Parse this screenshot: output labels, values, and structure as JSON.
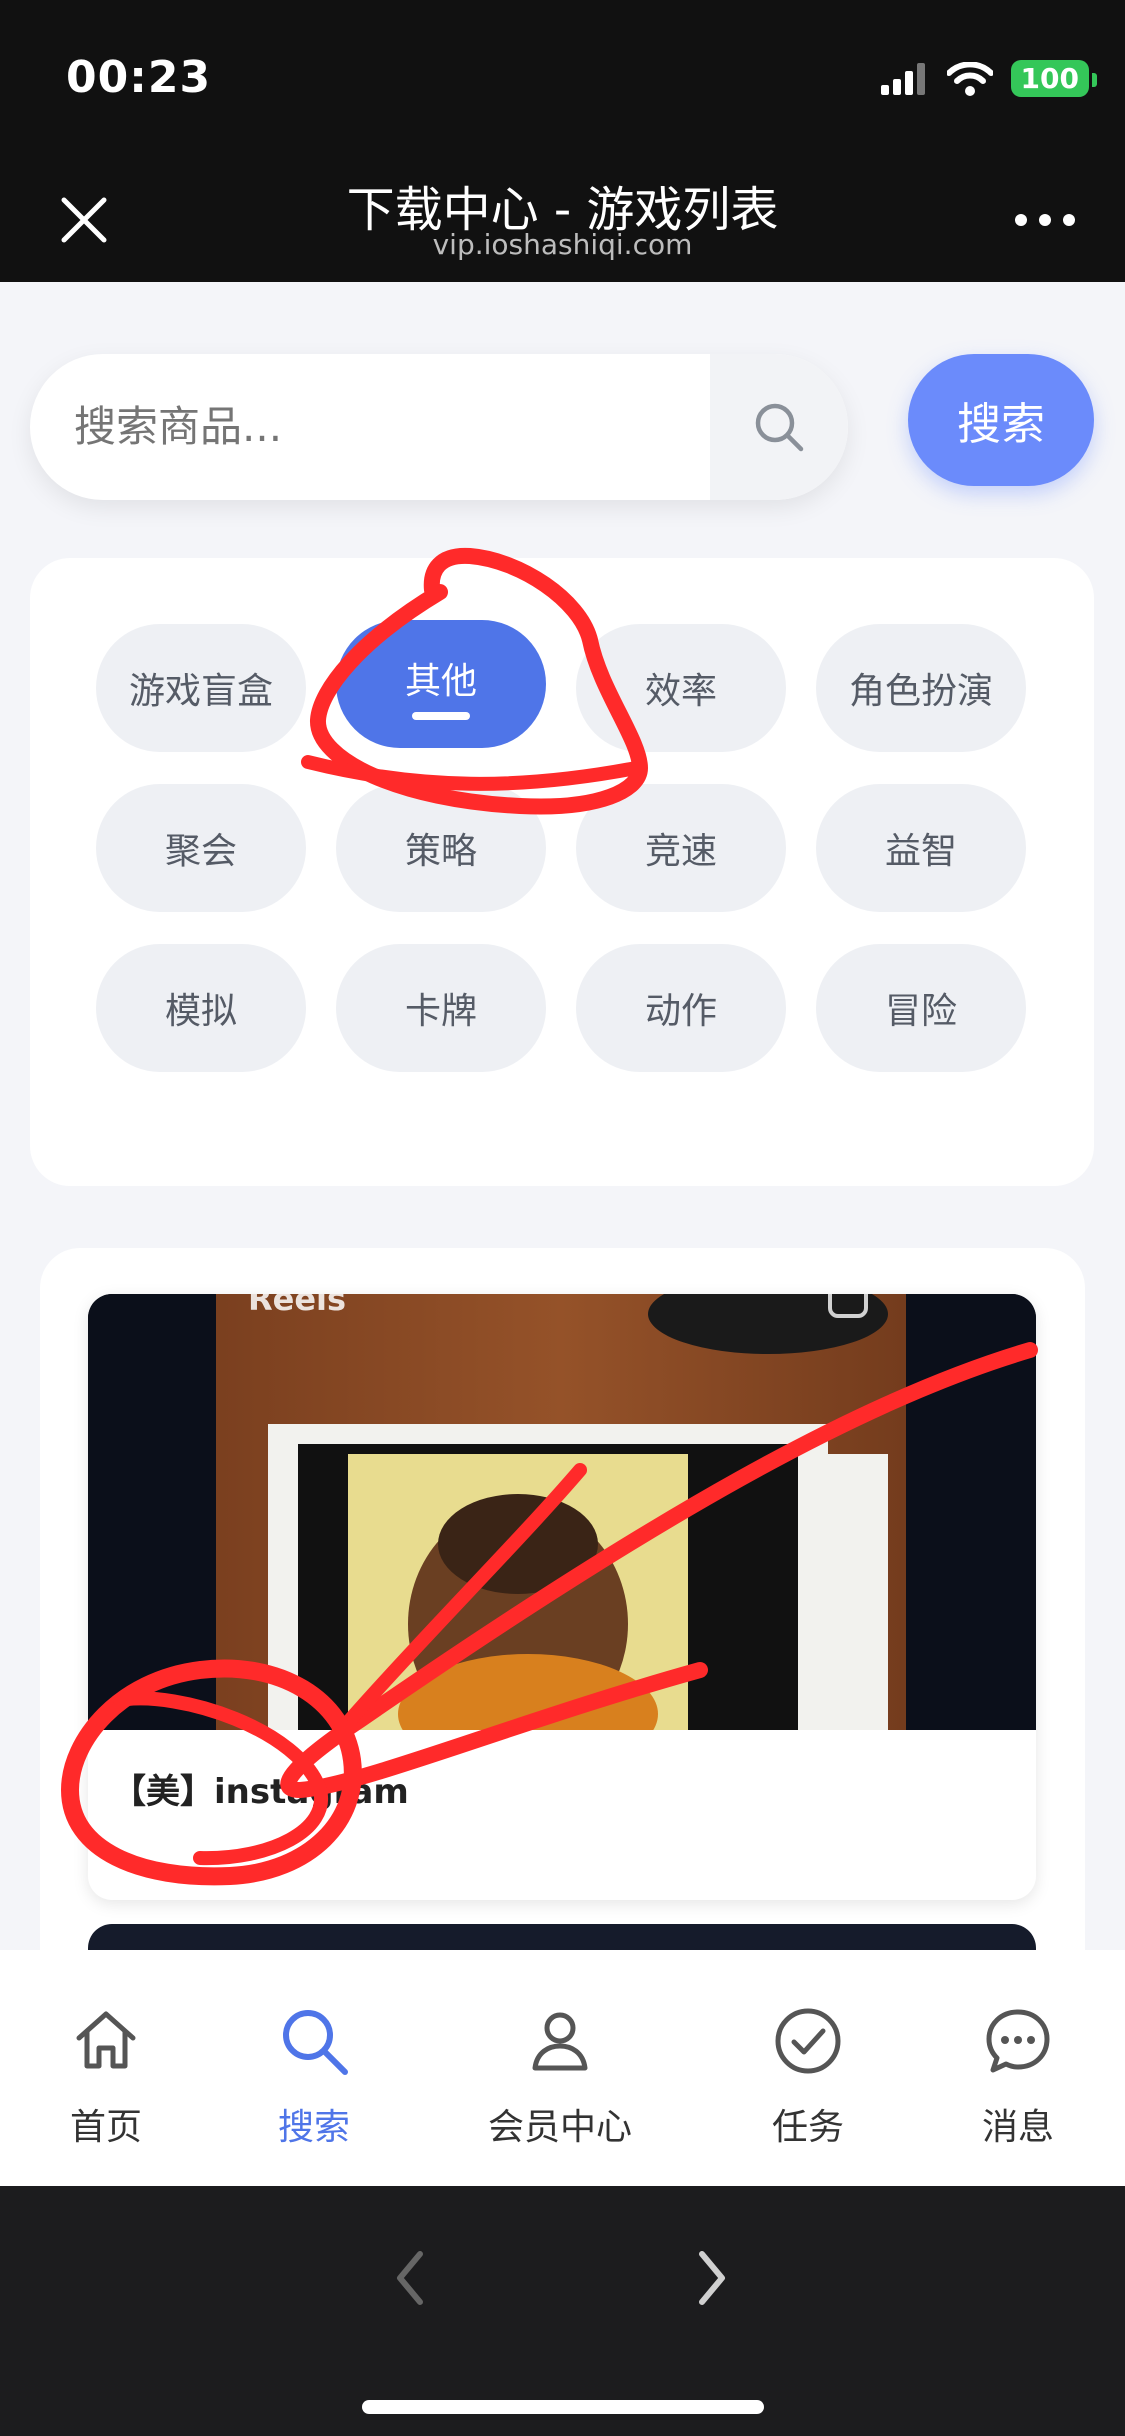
{
  "status_bar": {
    "time": "00:23",
    "battery": "100"
  },
  "nav": {
    "title": "下载中心 - 游戏列表",
    "url": "vip.ioshashiqi.com"
  },
  "search": {
    "placeholder": "搜索商品...",
    "button_label": "搜索"
  },
  "categories": [
    {
      "label": "游戏盲盒",
      "active": false
    },
    {
      "label": "其他",
      "active": true
    },
    {
      "label": "效率",
      "active": false
    },
    {
      "label": "角色扮演",
      "active": false
    },
    {
      "label": "聚会",
      "active": false
    },
    {
      "label": "策略",
      "active": false
    },
    {
      "label": "竞速",
      "active": false
    },
    {
      "label": "益智",
      "active": false
    },
    {
      "label": "模拟",
      "active": false
    },
    {
      "label": "卡牌",
      "active": false
    },
    {
      "label": "动作",
      "active": false
    },
    {
      "label": "冒险",
      "active": false
    }
  ],
  "products": [
    {
      "title": "【美】instagram",
      "image_label": "Reels"
    }
  ],
  "tab_bar": {
    "items": [
      {
        "label": "首页",
        "icon": "home-icon",
        "active": false
      },
      {
        "label": "搜索",
        "icon": "search-icon",
        "active": true
      },
      {
        "label": "会员中心",
        "icon": "user-icon",
        "active": false
      },
      {
        "label": "任务",
        "icon": "check-circle-icon",
        "active": false
      },
      {
        "label": "消息",
        "icon": "message-icon",
        "active": false
      }
    ]
  },
  "colors": {
    "accent": "#4f75e8",
    "search_button": "#6b8bfb",
    "annotation": "#ff2a2a"
  }
}
